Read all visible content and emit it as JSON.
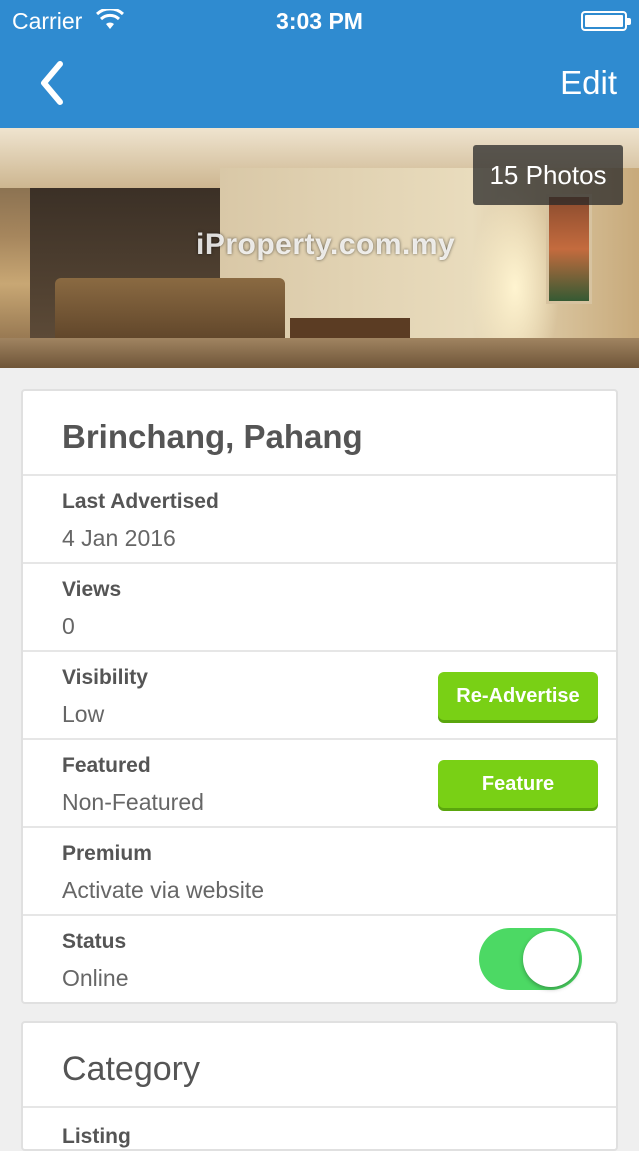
{
  "status_bar": {
    "carrier": "Carrier",
    "time": "3:03 PM"
  },
  "navbar": {
    "edit_label": "Edit",
    "back_icon": "chevron-left-icon"
  },
  "hero": {
    "photos_label": "15 Photos",
    "watermark": "iProperty.com.my"
  },
  "listing": {
    "title": "Brinchang, Pahang",
    "rows": [
      {
        "label": "Last Advertised",
        "value": "4 Jan 2016"
      },
      {
        "label": "Views",
        "value": "0"
      },
      {
        "label": "Visibility",
        "value": "Low",
        "button": "Re-Advertise"
      },
      {
        "label": "Featured",
        "value": "Non-Featured",
        "button": "Feature"
      },
      {
        "label": "Premium",
        "value": "Activate via website"
      },
      {
        "label": "Status",
        "value": "Online",
        "toggle_on": true
      }
    ]
  },
  "category": {
    "title": "Category",
    "first_row_label": "Listing"
  },
  "colors": {
    "accent": "#2f8bd0",
    "button_green": "#79d015",
    "toggle_green": "#4cd964"
  }
}
